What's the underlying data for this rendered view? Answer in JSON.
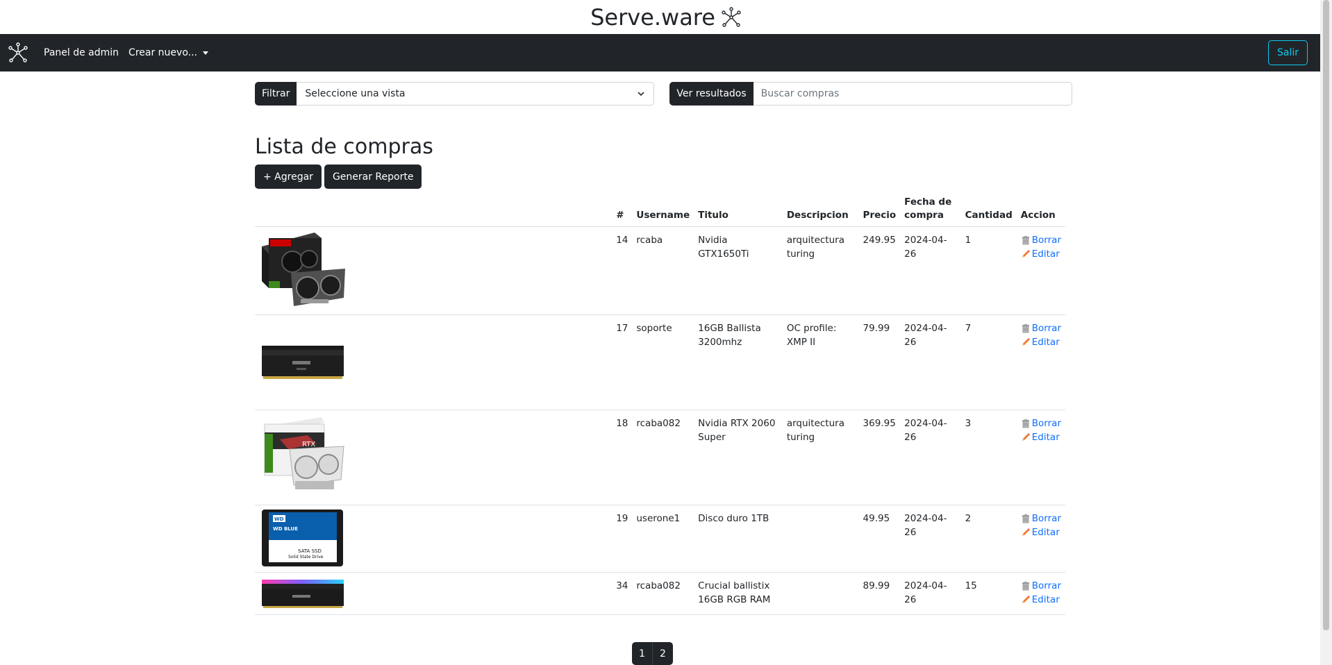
{
  "brand": {
    "title": "Serve.ware",
    "icon": "network-nodes-icon"
  },
  "navbar": {
    "logo_icon": "network-nodes-icon",
    "admin_panel": "Panel de admin",
    "create_new": "Crear nuevo...",
    "logout": "Salir"
  },
  "filter": {
    "label": "Filtrar",
    "select_value": "Seleccione una vista"
  },
  "search": {
    "button": "Ver resultados",
    "placeholder": "Buscar compras"
  },
  "page": {
    "title": "Lista de compras",
    "add_button": "+ Agregar",
    "report_button": "Generar Reporte"
  },
  "table": {
    "headers": {
      "id": "#",
      "username": "Username",
      "title": "Titulo",
      "description": "Descripcion",
      "price": "Precio",
      "date": "Fecha de compra",
      "quantity": "Cantidad",
      "action": "Accion"
    },
    "delete_label": "Borrar",
    "edit_label": "Editar",
    "rows": [
      {
        "image": "gpu-box-msi-image",
        "id": "14",
        "username": "rcaba",
        "title": "Nvidia GTX1650Ti",
        "description": "arquitectura turing",
        "price": "249.95",
        "date": "2024-04-26",
        "quantity": "1"
      },
      {
        "image": "ram-ballistix-image",
        "id": "17",
        "username": "soporte",
        "title": "16GB Ballista 3200mhz",
        "description": "OC profile: XMP II",
        "price": "79.99",
        "date": "2024-04-26",
        "quantity": "7"
      },
      {
        "image": "gpu-box-gigabyte-image",
        "id": "18",
        "username": "rcaba082",
        "title": "Nvidia RTX 2060 Super",
        "description": "arquitectura turing",
        "price": "369.95",
        "date": "2024-04-26",
        "quantity": "3"
      },
      {
        "image": "ssd-wd-blue-image",
        "id": "19",
        "username": "userone1",
        "title": "Disco duro 1TB",
        "description": "",
        "price": "49.95",
        "date": "2024-04-26",
        "quantity": "2"
      },
      {
        "image": "ram-rgb-image",
        "id": "34",
        "username": "rcaba082",
        "title": "Crucial ballistix 16GB RGB RAM",
        "description": "",
        "price": "89.99",
        "date": "2024-04-26",
        "quantity": "15"
      }
    ]
  },
  "pagination": {
    "pages": [
      "1",
      "2"
    ]
  },
  "ssd_label": {
    "brand": "WD",
    "line": "WD BLUE",
    "type": "SATA SSD",
    "sub": "Solid State Drive"
  },
  "colors": {
    "navbar": "#212529",
    "link": "#0d6efd",
    "outline_info": "#0dcaf0"
  }
}
